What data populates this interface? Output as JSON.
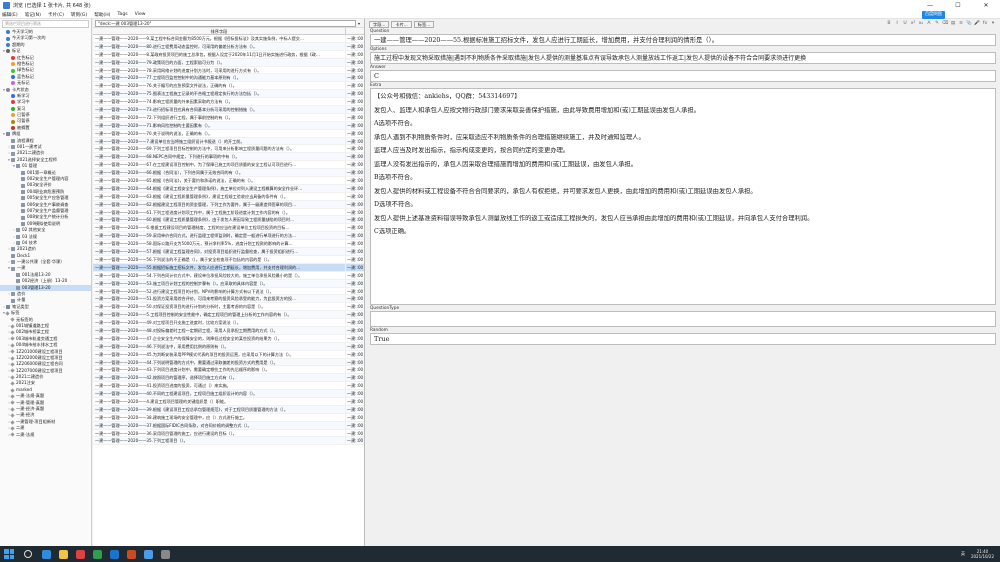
{
  "window": {
    "title": "浏览 (已选择 1 张卡片, 共 648 张)"
  },
  "menu": [
    "编辑(E)",
    "笔记(N)",
    "卡片(C)",
    "转到(G)",
    "帮助(H)",
    "Tags",
    "View"
  ],
  "sidebar": {
    "search_placeholder": "筛选栏项目进行筛选",
    "items": [
      {
        "indent": 0,
        "arrow": "",
        "icon": "dot",
        "color": "#3a7bd5",
        "label": "今天学习的"
      },
      {
        "indent": 0,
        "arrow": "",
        "icon": "dot",
        "color": "#3a7bd5",
        "label": "今天学习第一次的"
      },
      {
        "indent": 0,
        "arrow": "",
        "icon": "dot",
        "color": "#3a7bd5",
        "label": "超期的"
      },
      {
        "indent": 0,
        "arrow": "▾",
        "icon": "flag",
        "color": "#666",
        "label": "标记"
      },
      {
        "indent": 1,
        "arrow": "",
        "icon": "flag",
        "color": "#e33",
        "label": "红色标记"
      },
      {
        "indent": 1,
        "arrow": "",
        "icon": "flag",
        "color": "#f0a030",
        "label": "橙色标记"
      },
      {
        "indent": 1,
        "arrow": "",
        "icon": "flag",
        "color": "#3c3",
        "label": "绿色标记"
      },
      {
        "indent": 1,
        "arrow": "",
        "icon": "flag",
        "color": "#36f",
        "label": "蓝色标记"
      },
      {
        "indent": 1,
        "arrow": "",
        "icon": "flag",
        "color": "#c6c",
        "label": "无标记"
      },
      {
        "indent": 0,
        "arrow": "▾",
        "icon": "dot",
        "color": "#888",
        "label": "卡片状态"
      },
      {
        "indent": 1,
        "arrow": "",
        "icon": "dot",
        "color": "#36f",
        "label": "新学习"
      },
      {
        "indent": 1,
        "arrow": "",
        "icon": "dot",
        "color": "#e33",
        "label": "学习中"
      },
      {
        "indent": 1,
        "arrow": "",
        "icon": "dot",
        "color": "#3a3",
        "label": "复习"
      },
      {
        "indent": 1,
        "arrow": "",
        "icon": "dot",
        "color": "#f0a030",
        "label": "已暂停"
      },
      {
        "indent": 1,
        "arrow": "",
        "icon": "dot",
        "color": "#a80",
        "label": "可暂停"
      },
      {
        "indent": 1,
        "arrow": "",
        "icon": "dot",
        "color": "#c33",
        "label": "被搁置"
      },
      {
        "indent": 0,
        "arrow": "▾",
        "icon": "folder",
        "color": "#7a8aa0",
        "label": "牌组"
      },
      {
        "indent": 1,
        "arrow": "",
        "icon": "deck",
        "color": "",
        "label": "流程课程"
      },
      {
        "indent": 1,
        "arrow": "›",
        "icon": "deck",
        "color": "",
        "label": "001一建考试"
      },
      {
        "indent": 1,
        "arrow": "›",
        "icon": "deck",
        "color": "",
        "label": "2021二建造价"
      },
      {
        "indent": 1,
        "arrow": "▾",
        "icon": "deck",
        "color": "",
        "label": "2021选择安全工程师"
      },
      {
        "indent": 2,
        "arrow": "▾",
        "icon": "deck",
        "color": "",
        "label": "01 管理"
      },
      {
        "indent": 3,
        "arrow": "",
        "icon": "deck",
        "color": "",
        "label": "001第一章概论"
      },
      {
        "indent": 3,
        "arrow": "",
        "icon": "deck",
        "color": "",
        "label": "002安全生产管理内容"
      },
      {
        "indent": 3,
        "arrow": "",
        "icon": "deck",
        "color": "",
        "label": "003安全评价"
      },
      {
        "indent": 3,
        "arrow": "",
        "icon": "deck",
        "color": "",
        "label": "004职业病危害预防"
      },
      {
        "indent": 3,
        "arrow": "",
        "icon": "deck",
        "color": "",
        "label": "005安全生产应急管理"
      },
      {
        "indent": 3,
        "arrow": "",
        "icon": "deck",
        "color": "",
        "label": "006安全生产事故调查"
      },
      {
        "indent": 3,
        "arrow": "",
        "icon": "deck",
        "color": "",
        "label": "007安全生产监督管理"
      },
      {
        "indent": 3,
        "arrow": "",
        "icon": "deck",
        "color": "",
        "label": "008安全生产统计分析"
      },
      {
        "indent": 3,
        "arrow": "",
        "icon": "deck",
        "color": "",
        "label": "009模拟使用说明"
      },
      {
        "indent": 2,
        "arrow": "›",
        "icon": "deck",
        "color": "",
        "label": "02 其他安全"
      },
      {
        "indent": 2,
        "arrow": "›",
        "icon": "deck",
        "color": "",
        "label": "03 法规"
      },
      {
        "indent": 2,
        "arrow": "›",
        "icon": "deck",
        "color": "",
        "label": "04 技术"
      },
      {
        "indent": 1,
        "arrow": "›",
        "icon": "deck",
        "color": "",
        "label": "2021造价"
      },
      {
        "indent": 1,
        "arrow": "",
        "icon": "deck",
        "color": "",
        "label": "Deck1"
      },
      {
        "indent": 1,
        "arrow": "›",
        "icon": "deck",
        "color": "",
        "label": "一建公共课（全套·华课）"
      },
      {
        "indent": 1,
        "arrow": "▾",
        "icon": "deck",
        "color": "",
        "label": "一建"
      },
      {
        "indent": 2,
        "arrow": "",
        "icon": "deck",
        "color": "",
        "label": "001法规13-20"
      },
      {
        "indent": 2,
        "arrow": "",
        "icon": "deck",
        "color": "",
        "label": "002经济（上册）13-20"
      },
      {
        "indent": 2,
        "arrow": "",
        "icon": "deck",
        "color": "",
        "label": "003管理13-20"
      },
      {
        "indent": 1,
        "arrow": "›",
        "icon": "deck",
        "color": "",
        "label": "造价"
      },
      {
        "indent": 1,
        "arrow": "",
        "icon": "deck",
        "color": "",
        "label": "计量"
      },
      {
        "indent": 0,
        "arrow": "›",
        "icon": "folder",
        "color": "#7a8aa0",
        "label": "笔记类型"
      },
      {
        "indent": 0,
        "arrow": "▾",
        "icon": "tag",
        "color": "",
        "label": "标签"
      },
      {
        "indent": 1,
        "arrow": "",
        "icon": "tag",
        "color": "",
        "label": "无标签的"
      },
      {
        "indent": 1,
        "arrow": "›",
        "icon": "tag",
        "color": "",
        "label": "001城镇道路工程"
      },
      {
        "indent": 1,
        "arrow": "›",
        "icon": "tag",
        "color": "",
        "label": "002城市桥梁工程"
      },
      {
        "indent": 1,
        "arrow": "›",
        "icon": "tag",
        "color": "",
        "label": "003城市轨道交通工程"
      },
      {
        "indent": 1,
        "arrow": "›",
        "icon": "tag",
        "color": "",
        "label": "004城市给水排水工程"
      },
      {
        "indent": 1,
        "arrow": "›",
        "icon": "tag",
        "color": "",
        "label": "1Z201000建设工程项目"
      },
      {
        "indent": 1,
        "arrow": "›",
        "icon": "tag",
        "color": "",
        "label": "1Z202000建设工程项目"
      },
      {
        "indent": 1,
        "arrow": "›",
        "icon": "tag",
        "color": "",
        "label": "1Z206000建设工程合同"
      },
      {
        "indent": 1,
        "arrow": "›",
        "icon": "tag",
        "color": "",
        "label": "1Z207000建设工程项目"
      },
      {
        "indent": 1,
        "arrow": "›",
        "icon": "tag",
        "color": "",
        "label": "2021二建造价"
      },
      {
        "indent": 1,
        "arrow": "",
        "icon": "tag",
        "color": "",
        "label": "2021注安"
      },
      {
        "indent": 1,
        "arrow": "",
        "icon": "tag",
        "color": "",
        "label": "marked"
      },
      {
        "indent": 1,
        "arrow": "›",
        "icon": "tag",
        "color": "",
        "label": "一建-法规-真题"
      },
      {
        "indent": 1,
        "arrow": "›",
        "icon": "tag",
        "color": "",
        "label": "一建-管理-真题"
      },
      {
        "indent": 1,
        "arrow": "›",
        "icon": "tag",
        "color": "",
        "label": "一建-经济-真题"
      },
      {
        "indent": 1,
        "arrow": "›",
        "icon": "tag",
        "color": "",
        "label": "一建-经济"
      },
      {
        "indent": 1,
        "arrow": "›",
        "icon": "tag",
        "color": "",
        "label": "一建管理-项目组新材"
      },
      {
        "indent": 1,
        "arrow": "›",
        "icon": "tag",
        "color": "",
        "label": "二建"
      },
      {
        "indent": 1,
        "arrow": "›",
        "icon": "tag",
        "color": "",
        "label": "二建-法规"
      }
    ]
  },
  "browser": {
    "search_value": "\"deck:一建 003管理13-20\"",
    "col_sort": "排序字段",
    "col_deck": "",
    "rows": [
      {
        "q": "一建——管理——2020——9.某工程中标合同金额为8500万元。根据《招标投标法》及其实施条例，中标人提交…",
        "d": "一建::00"
      },
      {
        "q": "一建——管理——2020——80.进行工程费用动态监控时，可采用的偏差分析方法有（）。",
        "d": "一建::00"
      },
      {
        "q": "一建——管理——2020——8.某政府投资项目的施工总承包，根据人设定于2020年11月1日开始实施进行政务，根据《政…",
        "d": "一建::00"
      },
      {
        "q": "一建——管理——2020——79.政策项目的方面，工程索赔可分为（）。",
        "d": "一建::00"
      },
      {
        "q": "一建——管理——2020——78.采用网络计划的进度计划方法时，可采用的进行方式有（）。",
        "d": "一建::00"
      },
      {
        "q": "一建——管理——2020——77.工程项目监控控制中的沟通能力基本原则有（）。",
        "d": "一建::00"
      },
      {
        "q": "一建——管理——2020——76.关于编写的应急预案文件说法，正确的有（）。",
        "d": "一建::00"
      },
      {
        "q": "一建——管理——2020——75.图表法工程施工记录的不合格工程规定执行的方法包括（）。",
        "d": "一建::00"
      },
      {
        "q": "一建——管理——2020——74.影响工程质量的外来因素采取的方法有（）。",
        "d": "一建::00"
      },
      {
        "q": "一建——管理——2020——73.进行招标项目应具有合同基本分析可采用的控制措施（）。",
        "d": "一建::00"
      },
      {
        "q": "一建——管理——2020——72.下列组织进行工程，属于事前控制的有（）。",
        "d": "一建::00"
      },
      {
        "q": "一建——管理——2020——71.影响风险控制的主要因素有（）。",
        "d": "一建::00"
      },
      {
        "q": "一建——管理——2020——70.关于说明的说法，正确的有（）。",
        "d": "一建::00"
      },
      {
        "q": "一建——管理——2020——7.建设单位应当将施工组织设计书报送（）的开工前。",
        "d": "一建::00"
      },
      {
        "q": "一建——管理——2020——69.下列工程项目目标控制的方法中，可用来分析影响工程质量问题的方法有（）。",
        "d": "一建::00"
      },
      {
        "q": "一建——管理——2020——68.NEPC合同中规定，下列进行的事项的中有（）。",
        "d": "一建::00"
      },
      {
        "q": "一建——管理——2020——67.在工程建设项目控制中，为了保障已施工的项目质量的安全工程认可项目进行…",
        "d": "一建::00"
      },
      {
        "q": "一建——管理——2020——66.根据（合同法），下列合同属于无效合同的有（）。",
        "d": "一建::00"
      },
      {
        "q": "一建——管理——2020——65.根据《合同法》，关于要约和承诺的说法，正确的有（）。",
        "d": "一建::00"
      },
      {
        "q": "一建——管理——2020——64.根据《建设工程安全生产管理条例》，施工单位对列入建设工程概算的安全作业环…",
        "d": "一建::00"
      },
      {
        "q": "一建——管理——2020——63.根据《建设工程质量管理条例》，建设工程竣工验收应当具备的条件有（）。",
        "d": "一建::00"
      },
      {
        "q": "一建——管理——2020——62.根据建设工程项目的资金管理，下列工作为要件，属于一级建造师签章的项目…",
        "d": "一建::00"
      },
      {
        "q": "一建——管理——2020——61.下列工程进度计划项工作中，属于工程施工阶段进度计划工作内容的有（）。",
        "d": "一建::00"
      },
      {
        "q": "一建——管理——2020——60.根据《建设工程质量管理条例》，由于发包人原因导致工程质量缺陷的项目时…",
        "d": "一建::00"
      },
      {
        "q": "一建——管理——2020——6.根据工程建设项目的管理制度，工程的应当在建设单位工程项目投资的目标…",
        "d": "一建::00"
      },
      {
        "q": "一建——管理——2020——59.采用单价合同方式，进行监理工程师监测时，确定是一般进行单项进行的方法…",
        "d": "一建::00"
      },
      {
        "q": "一建——管理——2020——58.国际公路开支为5000万元，预计净利率5%，进度计划工程款的影响的计算…",
        "d": "一建::00"
      },
      {
        "q": "一建——管理——2020——57.根据《建设工程监理合同》，对投资项目组织进行监督检查，属于投资组织进行…",
        "d": "一建::00"
      },
      {
        "q": "一建——管理——2020——56.下列说法的不正确是（）。属于安全检查项不包括的内容的是（）。",
        "d": "一建::00"
      },
      {
        "q": "一建——管理——2020——55.根据招标施工招标文件，发包人应进行工期延长，增加费用，并支付合理利润的…",
        "d": "一建::00"
      },
      {
        "q": "一建——管理——2020——54.下列合同计价方式中，建设单位承担风险较大的，施工单位承担风险最小的是（）。",
        "d": "一建::00"
      },
      {
        "q": "一建——管理——2020——53.施工项目计划工程的控制步骤有（）。应采取的具体内容是（）。",
        "d": "一建::00"
      },
      {
        "q": "一建——管理——2020——52.进行建设工程项目的计划，NPV的影响的计算方式有以下说法（）。",
        "d": "一建::00"
      },
      {
        "q": "一建——管理——2020——51.投资方案采用综合评价，可用来考察的投资风险承受的能力，为此投资方的投…",
        "d": "一建::00"
      },
      {
        "q": "一建——管理——2020——50.对保证投资项目的进行计划的分析时，主要考虑的内容是（）。",
        "d": "一建::00"
      },
      {
        "q": "一建——管理——2020——5.工程项目控制的安全性能中，确定工程项目的管理上分析的工作内容的有（）。",
        "d": "一建::00"
      },
      {
        "q": "一建——管理——2020——49.对工程项目开支施工进度时，比较方案说法（）。",
        "d": "一建::00"
      },
      {
        "q": "一建——管理——2020——48.对投标偏差时工程一定期初工程，采用人员承担工期费用的方式（）。",
        "d": "一建::00"
      },
      {
        "q": "一建——管理——2020——47.企业安全生产的保障安全的，则降低过程安全的某些投资的结果为（）。",
        "d": "一建::00"
      },
      {
        "q": "一建——管理——2020——46.下列说法中，采用费用比例的原则有（）。",
        "d": "一建::00"
      },
      {
        "q": "一建——管理——2020——45.为判断安装采用PPP模式代表的项目的投资运营，应采用以下的计算方法（）。",
        "d": "一建::00"
      },
      {
        "q": "一建——管理——2020——44.下列说明管理的方式中，需要通过采取偏差的投资方式的费用是（）。",
        "d": "一建::00"
      },
      {
        "q": "一建——管理——2020——43.下列项目进度计划中，需要确定哪些工作的先后顺序的影响（）。",
        "d": "一建::00"
      },
      {
        "q": "一建——管理——2020——42.按照项目的管理序，选择项目施工方式有（）。",
        "d": "一建::00"
      },
      {
        "q": "一建——管理——2020——41.投资项目进度的投资，可通过（）来实施。",
        "d": "一建::00"
      },
      {
        "q": "一建——管理——2020——40.不同的工程建设项目，工程项目施工组织设计的内容（）。",
        "d": "一建::00"
      },
      {
        "q": "一建——管理——2020——4.建设工程项目管理的关键组织是（）职能。",
        "d": "一建::00"
      },
      {
        "q": "一建——管理——2020——39.根据《建设项目工程总承包管理规范》，对于工程项目质量管理的方法（）。",
        "d": "一建::00"
      },
      {
        "q": "一建——管理——2020——38.建筑施工现场的安全管理中，应（）方式进行施工。",
        "d": "一建::00"
      },
      {
        "q": "一建——管理——2020——37.根据国际FIDIC合同条款，对合同价格的调整方式（）。",
        "d": "一建::00"
      },
      {
        "q": "一建——管理——2020——36.采用项目管理的施工，应进行建设的目标（）。",
        "d": "一建::00"
      },
      {
        "q": "一建——管理——2020——35.下列工程项目（）。",
        "d": "一建::00"
      }
    ]
  },
  "editor": {
    "buttons": [
      "字段...",
      "卡片...",
      "标签..."
    ],
    "format_icons": [
      "B",
      "I",
      "U",
      "x²",
      "x₂",
      "A",
      "✎",
      "⌫",
      "▤",
      "≡",
      "📎",
      "🎤",
      "fx",
      "▾"
    ],
    "question_label": "Question",
    "question": "一建——管理——2020——55.根据标准施工招标文件，发包人应进行工期延长，增加费用，并支付合理利润的情形是（）。",
    "options_label": "Options",
    "options": "施工过程中发现文物采取措施|遇到不利物质条件采取措施|发包人提供的测量基准点有误导致承包人测量放线工作返工|发包人提供的设备不符合合同要求须进行更换",
    "answer_label": "Answer",
    "answer": "C",
    "extra_label": "Extra",
    "extra": [
      "【公众号和微信：ankiehs，QQ群：543314697】",
      "发包人、监理人和承包人应按文物行政部门要求采取妥善保护措施，由此导致费用增加和(或)工期延误由发包人承担。",
      "A选项不符合。",
      "承包人遇到不利物质条件时，应采取适应不利物质条件的合理措施继续施工，并及时通知监理人。",
      "监理人应当及时发出指示，指示构成变更的，按合同约定的变更办理。",
      "监理人没有发出指示的，承包人因采取合理措施而增加的费用和(或)工期延误，由发包人承担。",
      "B选项不符合。",
      "发包人提供的材料或工程设备不符合合同要求的，承包人有权拒绝，并可要求发包人更换，由此增加的费用和(或)工期延误由发包人承担。",
      "D选项不符合。",
      "发包人提供上述基准资料错误导致承包人测量放线工作的返工或造成工程损失的，发包人应当承担由此增加的费用和(或)工期延误，并向承包人支付合理利润。",
      "C选项正确。"
    ],
    "qtype_label": "QuestionType",
    "qtype": "",
    "random_label": "Random",
    "random": "True"
  },
  "cloud_badge": "百度网盘",
  "taskbar": {
    "time": "21:40",
    "date": "2021/10/22",
    "lang": "英"
  },
  "colors": {
    "selected_row": "#c9dcf5",
    "taskbar": "#1f2a33",
    "accent": "#3a7bd5"
  }
}
